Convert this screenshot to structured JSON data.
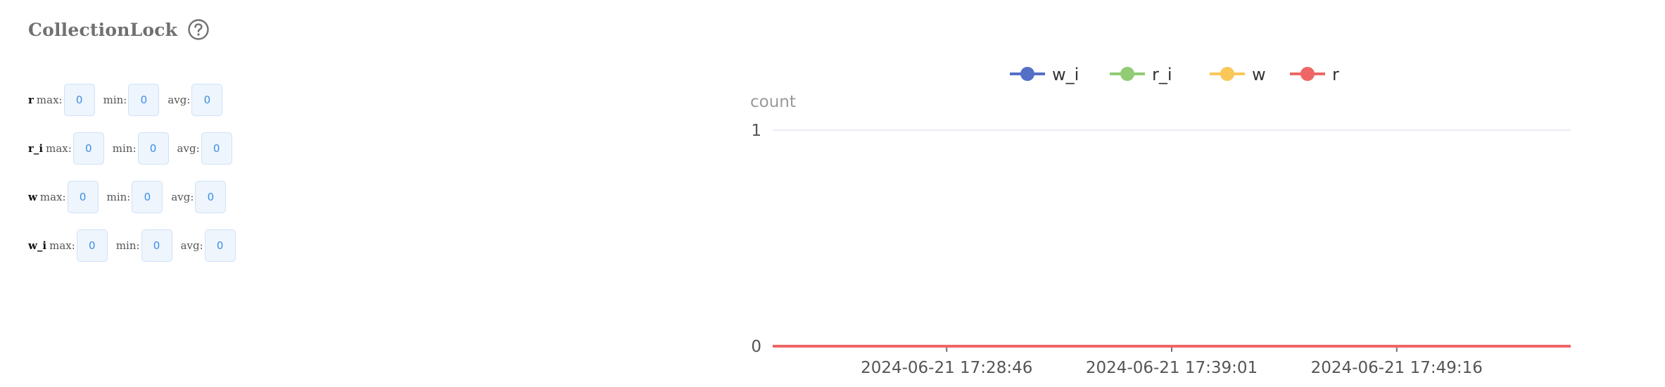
{
  "panel": {
    "title": "CollectionLock"
  },
  "icons": {
    "help": "help-circle-icon"
  },
  "stats": [
    {
      "name": "r",
      "max_label": "max:",
      "max": "0",
      "min_label": "min:",
      "min": "0",
      "avg_label": "avg:",
      "avg": "0"
    },
    {
      "name": "r_i",
      "max_label": "max:",
      "max": "0",
      "min_label": "min:",
      "min": "0",
      "avg_label": "avg:",
      "avg": "0"
    },
    {
      "name": "w",
      "max_label": "max:",
      "max": "0",
      "min_label": "min:",
      "min": "0",
      "avg_label": "avg:",
      "avg": "0"
    },
    {
      "name": "w_i",
      "max_label": "max:",
      "max": "0",
      "min_label": "min:",
      "min": "0",
      "avg_label": "avg:",
      "avg": "0"
    }
  ],
  "colors": {
    "w_i": "#5470c6",
    "r_i": "#91cc75",
    "w": "#fac858",
    "r": "#ee6666",
    "stat_value": "#3a8ee6",
    "stat_bg": "#eef5fd",
    "grid": "#e0e6f1"
  },
  "chart_data": {
    "type": "line",
    "ylabel": "count",
    "ylim": [
      0,
      1
    ],
    "y_ticks": [
      "0",
      "1"
    ],
    "x_ticks": [
      "2024-06-21 17:28:46",
      "2024-06-21 17:39:01",
      "2024-06-21 17:49:16"
    ],
    "x_tick_fractions": [
      0.218,
      0.5,
      0.782
    ],
    "legend_position": "top-center",
    "series": [
      {
        "name": "w_i",
        "values": [
          0,
          0
        ]
      },
      {
        "name": "r_i",
        "values": [
          0,
          0
        ]
      },
      {
        "name": "w",
        "values": [
          0,
          0
        ]
      },
      {
        "name": "r",
        "values": [
          0,
          0
        ]
      }
    ]
  }
}
